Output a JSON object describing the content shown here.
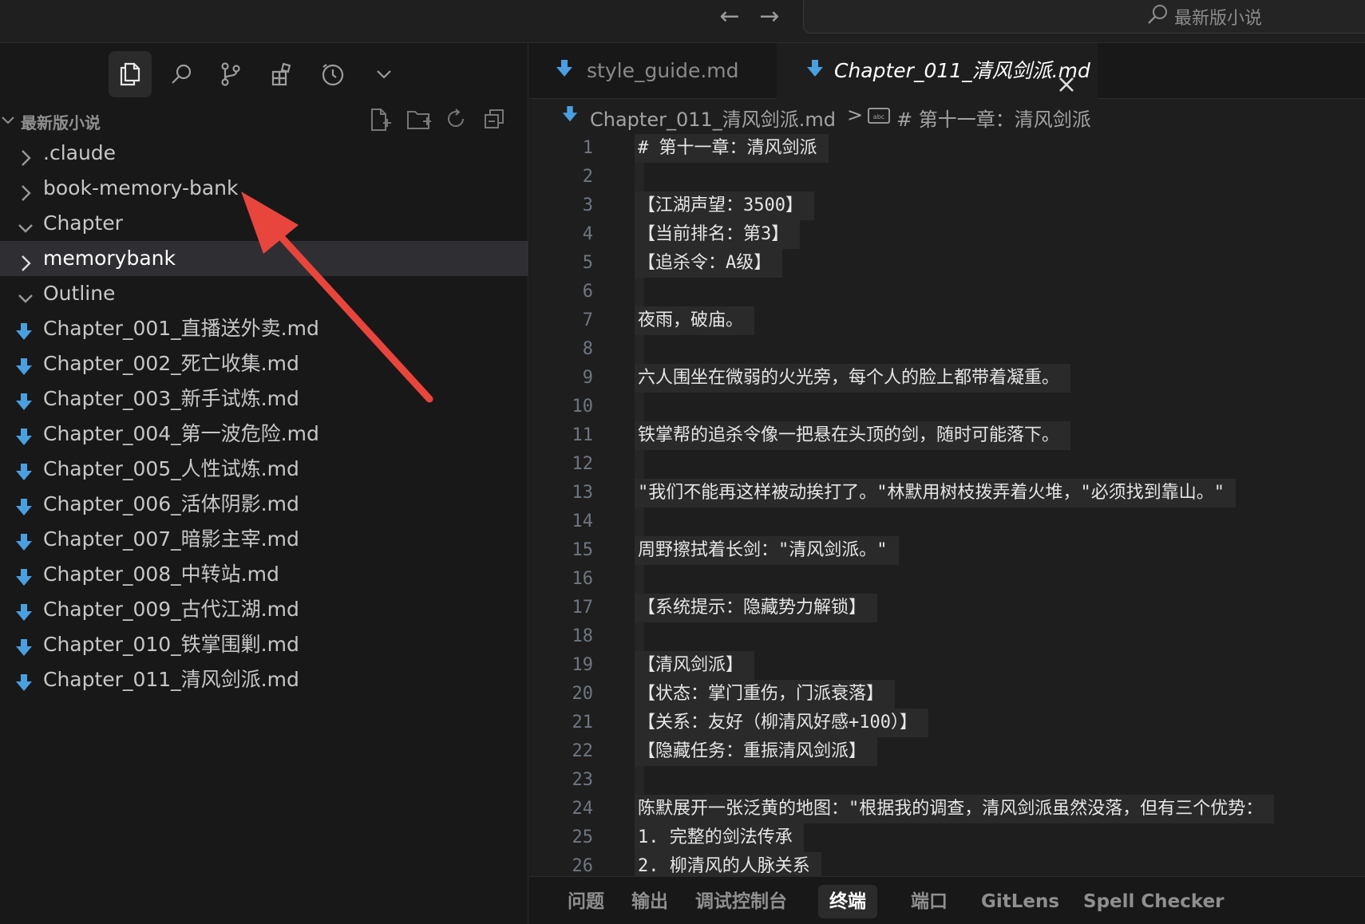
{
  "title_bar": {
    "back_icon": "arrow-left-icon",
    "forward_icon": "arrow-right-icon",
    "command_center_label": "最新版小说"
  },
  "activity_bar": {
    "items": [
      {
        "name": "explorer",
        "icon": "files-icon",
        "active": true
      },
      {
        "name": "search",
        "icon": "search-icon",
        "active": false
      },
      {
        "name": "source-control",
        "icon": "git-branch-icon",
        "active": false
      },
      {
        "name": "extensions",
        "icon": "extensions-icon",
        "active": false
      },
      {
        "name": "timeline",
        "icon": "clock-icon",
        "active": false
      },
      {
        "name": "more",
        "icon": "chevron-down-icon",
        "active": false
      }
    ]
  },
  "explorer": {
    "folder_name": "最新版小说",
    "actions": [
      "new-file-icon",
      "new-folder-icon",
      "refresh-icon",
      "collapse-all-icon"
    ],
    "items": [
      {
        "label": ".claude",
        "kind": "folder",
        "expanded": false
      },
      {
        "label": "book-memory-bank",
        "kind": "folder",
        "expanded": false
      },
      {
        "label": "Chapter",
        "kind": "folder",
        "expanded": true
      },
      {
        "label": "memorybank",
        "kind": "folder",
        "expanded": false,
        "selected": true
      },
      {
        "label": "Outline",
        "kind": "folder",
        "expanded": true
      },
      {
        "label": "Chapter_001_直播送外卖.md",
        "kind": "file"
      },
      {
        "label": "Chapter_002_死亡收集.md",
        "kind": "file"
      },
      {
        "label": "Chapter_003_新手试炼.md",
        "kind": "file"
      },
      {
        "label": "Chapter_004_第一波危险.md",
        "kind": "file"
      },
      {
        "label": "Chapter_005_人性试炼.md",
        "kind": "file"
      },
      {
        "label": "Chapter_006_活体阴影.md",
        "kind": "file"
      },
      {
        "label": "Chapter_007_暗影主宰.md",
        "kind": "file"
      },
      {
        "label": "Chapter_008_中转站.md",
        "kind": "file"
      },
      {
        "label": "Chapter_009_古代江湖.md",
        "kind": "file"
      },
      {
        "label": "Chapter_010_铁掌围剿.md",
        "kind": "file"
      },
      {
        "label": "Chapter_011_清风剑派.md",
        "kind": "file"
      }
    ]
  },
  "editor": {
    "tabs": [
      {
        "label": "style_guide.md",
        "active": false
      },
      {
        "label": "Chapter_011_清风剑派.md",
        "active": true
      }
    ],
    "breadcrumb": {
      "file": "Chapter_011_清风剑派.md",
      "separator": ">",
      "symbol_icon": "abc-symbol-icon",
      "symbol": "# 第十一章：清风剑派"
    },
    "lines": [
      {
        "n": "1",
        "t": "# 第十一章：清风剑派"
      },
      {
        "n": "2",
        "t": ""
      },
      {
        "n": "3",
        "t": "【江湖声望：3500】"
      },
      {
        "n": "4",
        "t": "【当前排名：第3】"
      },
      {
        "n": "5",
        "t": "【追杀令：A级】"
      },
      {
        "n": "6",
        "t": ""
      },
      {
        "n": "7",
        "t": "夜雨，破庙。"
      },
      {
        "n": "8",
        "t": ""
      },
      {
        "n": "9",
        "t": "六人围坐在微弱的火光旁，每个人的脸上都带着凝重。"
      },
      {
        "n": "10",
        "t": ""
      },
      {
        "n": "11",
        "t": "铁掌帮的追杀令像一把悬在头顶的剑，随时可能落下。"
      },
      {
        "n": "12",
        "t": ""
      },
      {
        "n": "13",
        "t": "\"我们不能再这样被动挨打了。\"林默用树枝拨弄着火堆，\"必须找到靠山。\""
      },
      {
        "n": "14",
        "t": ""
      },
      {
        "n": "15",
        "t": "周野擦拭着长剑：\"清风剑派。\""
      },
      {
        "n": "16",
        "t": ""
      },
      {
        "n": "17",
        "t": "【系统提示：隐藏势力解锁】"
      },
      {
        "n": "18",
        "t": ""
      },
      {
        "n": "19",
        "t": "【清风剑派】"
      },
      {
        "n": "20",
        "t": "【状态：掌门重伤，门派衰落】"
      },
      {
        "n": "21",
        "t": "【关系：友好（柳清风好感+100）】"
      },
      {
        "n": "22",
        "t": "【隐藏任务：重振清风剑派】"
      },
      {
        "n": "23",
        "t": ""
      },
      {
        "n": "24",
        "t": "陈默展开一张泛黄的地图：\"根据我的调查，清风剑派虽然没落，但有三个优势："
      },
      {
        "n": "25",
        "t": "1. 完整的剑法传承"
      },
      {
        "n": "26",
        "t": "2. 柳清风的人脉关系"
      }
    ]
  },
  "panel": {
    "tabs": [
      {
        "label": "问题",
        "active": false
      },
      {
        "label": "输出",
        "active": false
      },
      {
        "label": "调试控制台",
        "active": false
      },
      {
        "label": "终端",
        "active": true
      },
      {
        "label": "端口",
        "active": false
      },
      {
        "label": "GitLens",
        "active": false
      },
      {
        "label": "Spell Checker",
        "active": false
      }
    ]
  },
  "annotation": {
    "icon": "red-arrow-annotation",
    "color": "#e8453c"
  },
  "colors": {
    "markdown_icon": "#4a9fe0",
    "accent": "#e8453c"
  }
}
